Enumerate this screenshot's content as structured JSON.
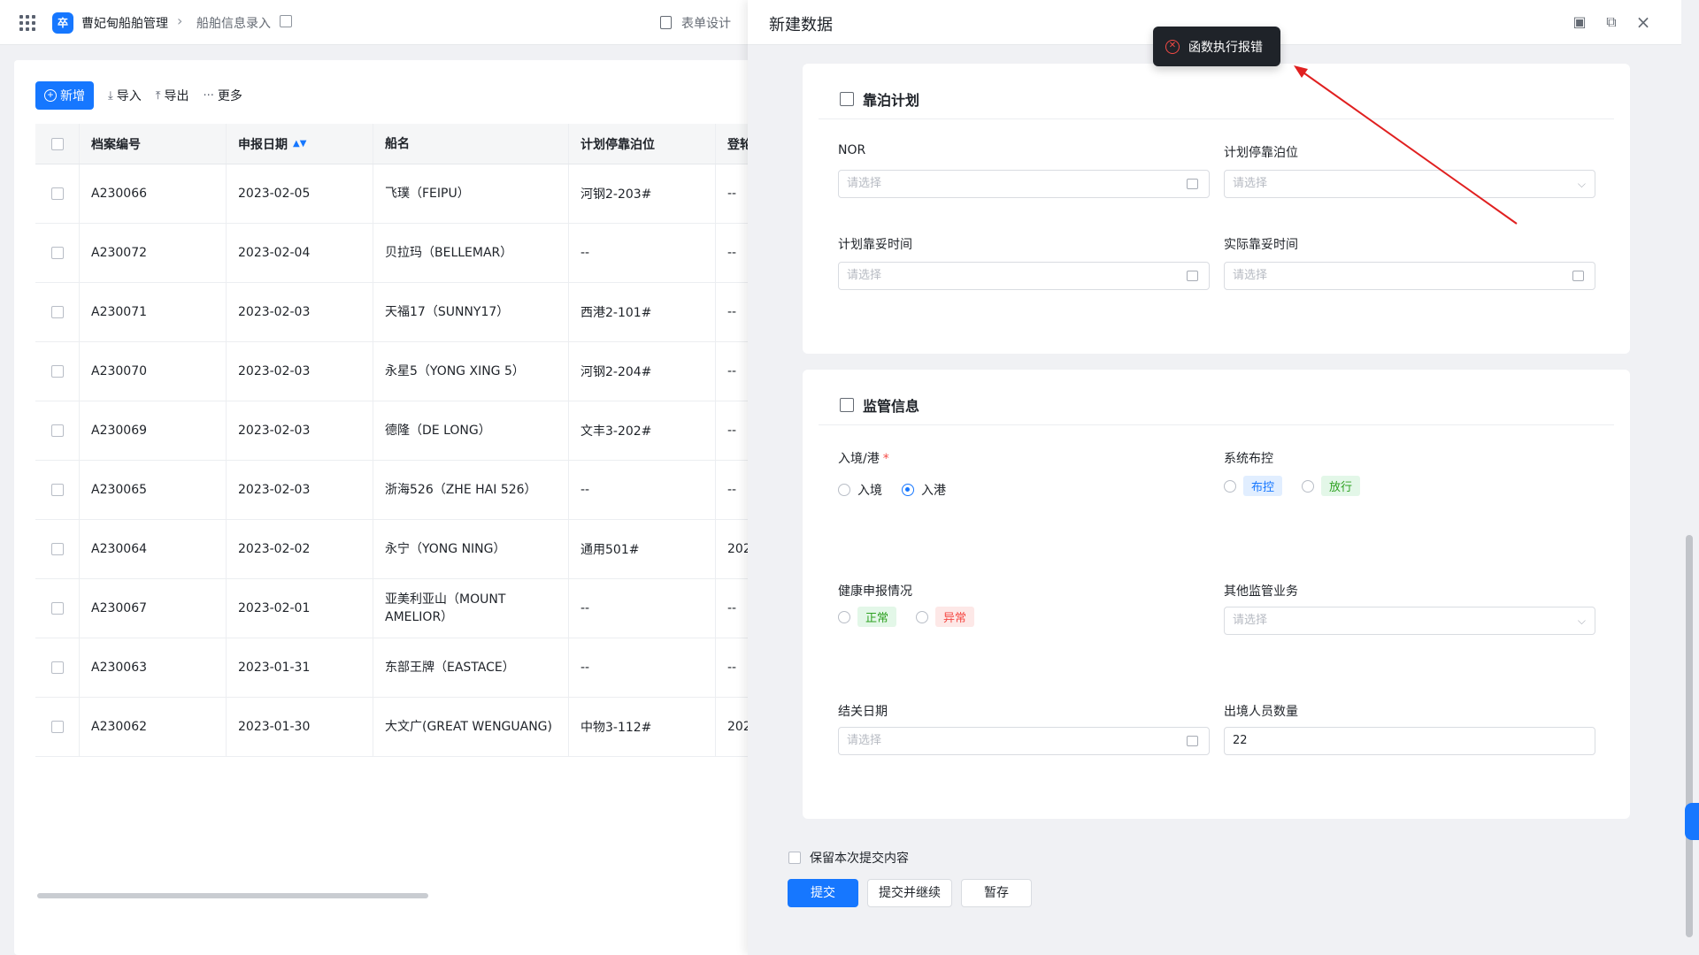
{
  "header": {
    "app_name": "曹妃甸船舶管理",
    "page_name": "船舶信息录入",
    "form_design": "表单设计",
    "logo_char": "卒"
  },
  "toolbar": {
    "new_label": "新增",
    "import_label": "导入",
    "export_label": "导出",
    "more_label": "更多"
  },
  "table": {
    "columns": [
      "档案编号",
      "申报日期",
      "船名",
      "计划停靠泊位",
      "登轮"
    ],
    "rows": [
      {
        "id": "A230066",
        "date": "2023-02-05",
        "name": "飞璞（FEIPU）",
        "berth": "河钢2-203#",
        "extra": "--"
      },
      {
        "id": "A230072",
        "date": "2023-02-04",
        "name": "贝拉玛（BELLEMAR）",
        "berth": "--",
        "extra": "--"
      },
      {
        "id": "A230071",
        "date": "2023-02-03",
        "name": "天福17（SUNNY17）",
        "berth": "西港2-101#",
        "extra": "--"
      },
      {
        "id": "A230070",
        "date": "2023-02-03",
        "name": "永星5（YONG XING 5）",
        "berth": "河钢2-204#",
        "extra": "--"
      },
      {
        "id": "A230069",
        "date": "2023-02-03",
        "name": "德隆（DE LONG）",
        "berth": "文丰3-202#",
        "extra": "--"
      },
      {
        "id": "A230065",
        "date": "2023-02-03",
        "name": "浙海526（ZHE HAI 526）",
        "berth": "--",
        "extra": "--"
      },
      {
        "id": "A230064",
        "date": "2023-02-02",
        "name": "永宁（YONG NING）",
        "berth": "通用501#",
        "extra": "202"
      },
      {
        "id": "A230067",
        "date": "2023-02-01",
        "name": "亚美利亚山（MOUNT AMELIOR）",
        "berth": "--",
        "extra": "--"
      },
      {
        "id": "A230063",
        "date": "2023-01-31",
        "name": "东部王牌（EASTACE）",
        "berth": "--",
        "extra": "--"
      },
      {
        "id": "A230062",
        "date": "2023-01-30",
        "name": "大文广(GREAT WENGUANG)",
        "berth": "中物3-112#",
        "extra": "202"
      }
    ]
  },
  "drawer": {
    "title": "新建数据",
    "toast": "函数执行报错",
    "berthing": {
      "title": "靠泊计划",
      "nor_label": "NOR",
      "nor_placeholder": "请选择",
      "planned_berth_label": "计划停靠泊位",
      "planned_berth_placeholder": "请选择",
      "planned_time_label": "计划靠妥时间",
      "planned_time_placeholder": "请选择",
      "actual_time_label": "实际靠妥时间",
      "actual_time_placeholder": "请选择"
    },
    "supervision": {
      "title": "监管信息",
      "entry_label": "入境/港",
      "entry_required": "*",
      "entry_opt1": "入境",
      "entry_opt2": "入港",
      "system_label": "系统布控",
      "system_opt1": "布控",
      "system_opt2": "放行",
      "health_label": "健康申报情况",
      "health_opt1": "正常",
      "health_opt2": "异常",
      "other_label": "其他监管业务",
      "other_placeholder": "请选择",
      "clear_date_label": "结关日期",
      "clear_date_placeholder": "请选择",
      "exit_count_label": "出境人员数量",
      "exit_count_value": "22"
    },
    "footer": {
      "keep_label": "保留本次提交内容",
      "submit": "提交",
      "submit_continue": "提交并继续",
      "save_draft": "暂存"
    }
  },
  "colors": {
    "primary": "#1677ff",
    "error": "#f54a45",
    "success": "#2ea121"
  }
}
